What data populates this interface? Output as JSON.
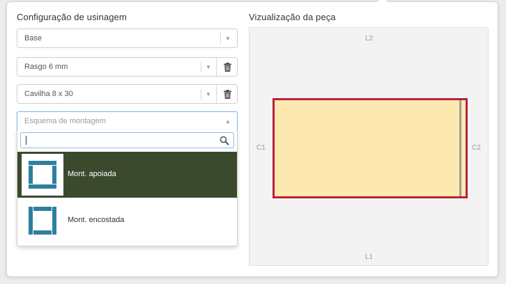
{
  "left_panel": {
    "title": "Configuração de usinagem",
    "select_base": {
      "value": "Base",
      "caret": "▼"
    },
    "select_groove": {
      "value": "Rasgo 6 mm",
      "caret": "▼"
    },
    "select_dowel": {
      "value": "Cavilha 8 x 30",
      "caret": "▼"
    },
    "select_assembly": {
      "placeholder": "Esquema de montagem",
      "caret": "▲"
    },
    "dropdown": {
      "search_value": "",
      "options": [
        {
          "label": "Mont. apoiada",
          "selected": true,
          "icon": "supported-assembly-icon"
        },
        {
          "label": "Mont. encostada",
          "selected": false,
          "icon": "butted-assembly-icon"
        }
      ]
    }
  },
  "right_panel": {
    "title": "Vizualização da peça",
    "edge_labels": {
      "top": "L2",
      "bottom": "L1",
      "left": "C1",
      "right": "C2"
    }
  },
  "colors": {
    "selected_option_bg": "#3b4a2d",
    "piece_fill": "#fde9b0",
    "piece_border": "#b8213d",
    "icon_blue": "#2e7fa0",
    "focus_border": "#8fb7e6"
  }
}
